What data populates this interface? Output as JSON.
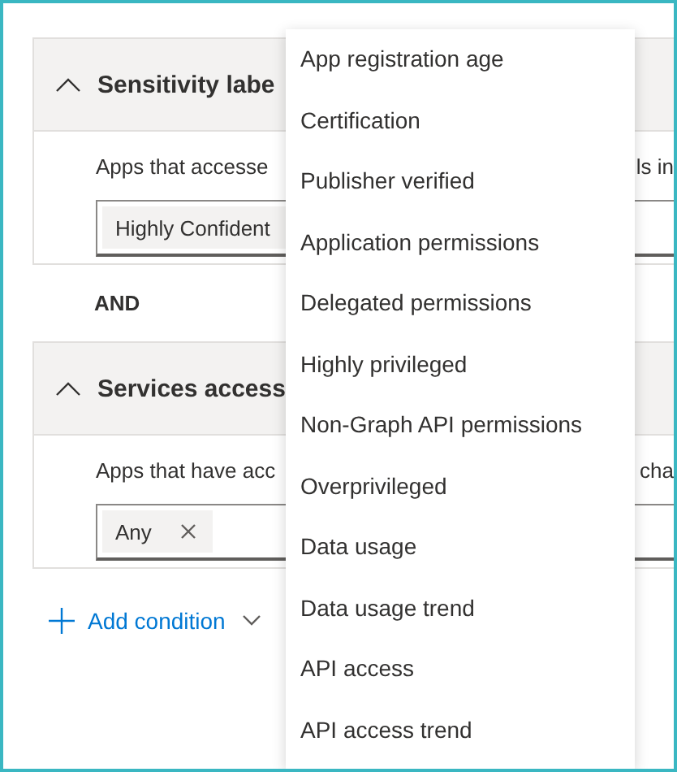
{
  "panels": [
    {
      "title": "Sensitivity labe",
      "expanded": true,
      "description": "Apps that accesse",
      "description_tail": "ls in",
      "chips": [
        {
          "label": "Highly Confident"
        }
      ]
    },
    {
      "title": "Services access",
      "expanded": true,
      "description": "Apps that have acc",
      "description_tail": "cha",
      "chips": [
        {
          "label": "Any",
          "removable": true
        }
      ]
    }
  ],
  "connector": "AND",
  "add_condition": {
    "label": "Add condition"
  },
  "menu": {
    "items": [
      {
        "label": "App registration age"
      },
      {
        "label": "Certification"
      },
      {
        "label": "Publisher verified"
      },
      {
        "label": "Application permissions"
      },
      {
        "label": "Delegated permissions"
      },
      {
        "label": "Highly privileged"
      },
      {
        "label": "Non-Graph API permissions"
      },
      {
        "label": "Overprivileged"
      },
      {
        "label": "Data usage"
      },
      {
        "label": "Data usage trend"
      },
      {
        "label": "API access"
      },
      {
        "label": "API access trend"
      }
    ]
  }
}
